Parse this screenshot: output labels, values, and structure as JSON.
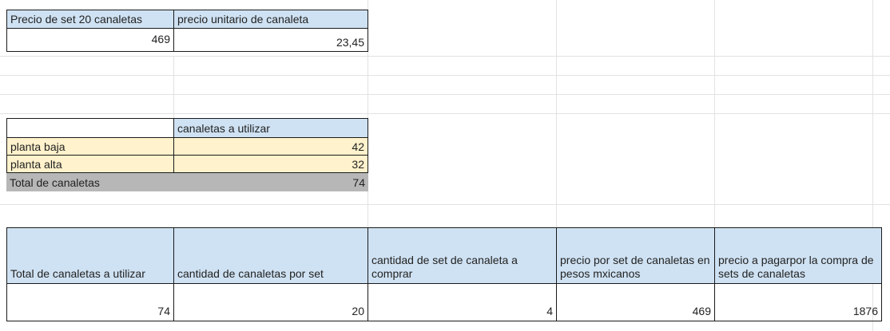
{
  "price_table": {
    "header_set_price": "Precio de set 20 canaletas",
    "header_unit_price": "precio unitario de canaleta",
    "set_price": "469",
    "unit_price": "23,45"
  },
  "usage_table": {
    "header": "canaletas a utilizar",
    "rows": [
      {
        "label": "planta baja",
        "value": "42"
      },
      {
        "label": "planta alta",
        "value": "32"
      }
    ],
    "total_label": "Total de canaletas",
    "total_value": "74"
  },
  "summary_table": {
    "headers": [
      "Total de canaletas a utilizar",
      "cantidad de canaletas por set",
      "cantidad de set de canaleta a comprar",
      "precio por set de canaletas en pesos mxicanos",
      "precio a pagarpor la compra de sets de canaletas"
    ],
    "values": [
      "74",
      "20",
      "4",
      "469",
      "1876"
    ]
  },
  "colors": {
    "header_blue": "#cfe2f3",
    "row_cream": "#fff2cc",
    "total_gray": "#b7b7b7"
  }
}
